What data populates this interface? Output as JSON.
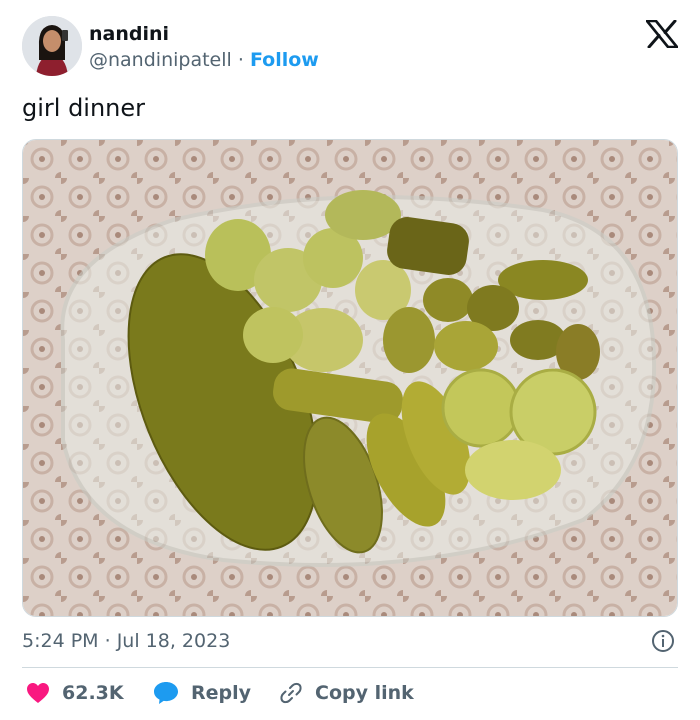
{
  "author": {
    "name": "nandini",
    "handle": "@nandinipatell",
    "separator": "·",
    "follow_label": "Follow"
  },
  "tweet": {
    "text": "girl dinner",
    "time": "5:24 PM",
    "date": "Jul 18, 2023"
  },
  "actions": {
    "likes": "62.3K",
    "reply_label": "Reply",
    "copy_label": "Copy link"
  },
  "icons": {
    "logo": "x-logo-icon",
    "like": "heart-icon",
    "reply": "speech-bubble-icon",
    "copy": "link-icon",
    "info": "info-icon"
  },
  "colors": {
    "accent": "#1d9bf0",
    "like": "#f91880",
    "text": "#0f1419",
    "muted": "#536471"
  }
}
